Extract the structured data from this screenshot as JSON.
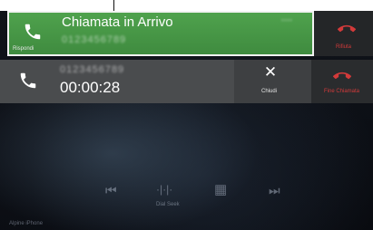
{
  "incoming": {
    "title": "Chiamata in Arrivo",
    "answer_label": "Rispondi",
    "reject_label": "Rifiuta",
    "caller_number": "0123456789"
  },
  "active": {
    "caller_number": "0123456789",
    "timer": "00:00:28",
    "close_label": "Chiudi",
    "end_call_label": "Fine Chiamata"
  },
  "controls": {
    "dial_label": "Dial Seek"
  },
  "bottom": {
    "source_label": "Alpine iPhone"
  }
}
